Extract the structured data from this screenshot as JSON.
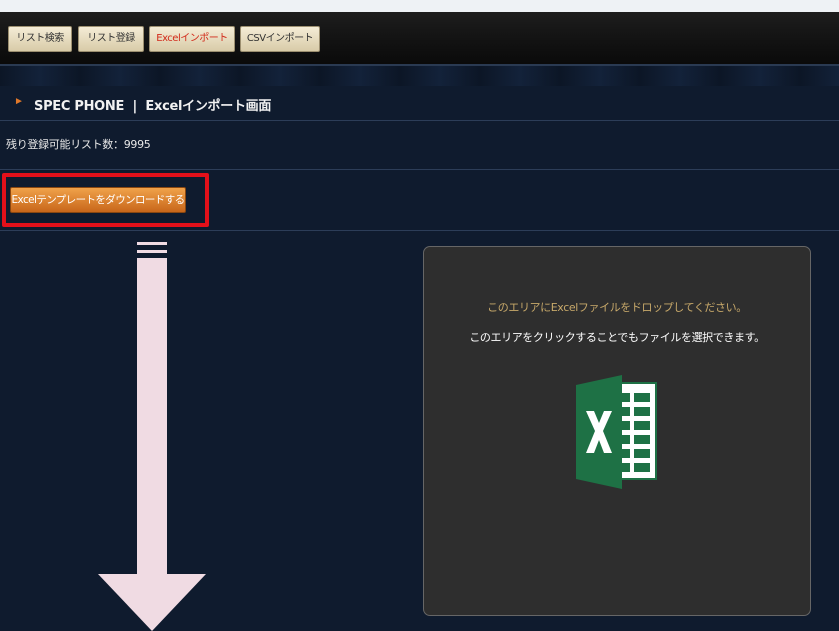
{
  "toolbar": {
    "buttons": [
      {
        "label": "リスト検索",
        "active": false
      },
      {
        "label": "リスト登録",
        "active": false
      },
      {
        "label": "Excelインポート",
        "active": true
      },
      {
        "label": "CSVインポート",
        "active": false
      }
    ]
  },
  "header": {
    "title": "SPEC PHONE  |  Excelインポート画面"
  },
  "info": {
    "remaining": "残り登録可能リスト数：9995"
  },
  "actions": {
    "download_template": "Excelテンプレートをダウンロードする"
  },
  "dropzone": {
    "line1": "このエリアにExcelファイルをドロップしてください。",
    "line2": "このエリアをクリックすることでもファイルを選択できます。",
    "icon": "excel-icon"
  },
  "colors": {
    "highlight": "#e3101a",
    "download_button": "#e0862e",
    "guide_arrow": "#f0dbe3",
    "excel_green": "#1e7145"
  }
}
